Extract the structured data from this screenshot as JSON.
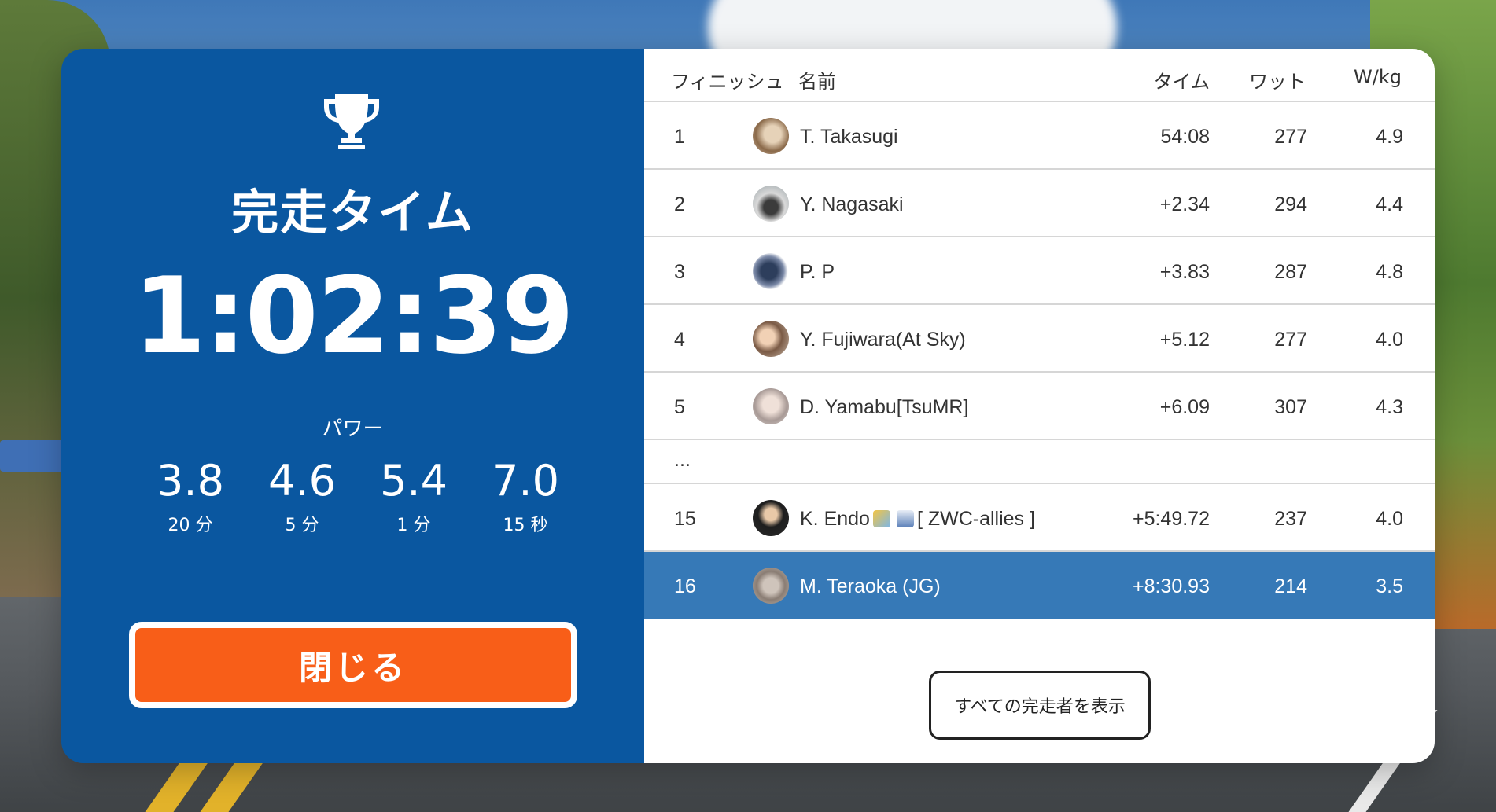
{
  "summary": {
    "title": "完走タイム",
    "finish_time": "1:02:39",
    "power_label": "パワー",
    "power": [
      {
        "value": "3.8",
        "duration": "20 分"
      },
      {
        "value": "4.6",
        "duration": "5 分"
      },
      {
        "value": "5.4",
        "duration": "1 分"
      },
      {
        "value": "7.0",
        "duration": "15 秒"
      }
    ],
    "close_label": "閉じる",
    "trophy_icon": "trophy-icon",
    "close_color": "#f85e18",
    "panel_color": "#0a57a0"
  },
  "table": {
    "headers": {
      "finish": "フィニッシュ",
      "name": "名前",
      "time": "タイム",
      "watt": "ワット",
      "wkg": "W/kg"
    },
    "rows": [
      {
        "pos": "1",
        "name": "T. Takasugi",
        "time": "54:08",
        "watt": "277",
        "wkg": "4.9"
      },
      {
        "pos": "2",
        "name": "Y. Nagasaki",
        "time": "+2.34",
        "watt": "294",
        "wkg": "4.4"
      },
      {
        "pos": "3",
        "name": "P. P",
        "time": "+3.83",
        "watt": "287",
        "wkg": "4.8"
      },
      {
        "pos": "4",
        "name": "Y. Fujiwara(At Sky)",
        "time": "+5.12",
        "watt": "277",
        "wkg": "4.0"
      },
      {
        "pos": "5",
        "name": "D. Yamabu[TsuMR]",
        "time": "+6.09",
        "watt": "307",
        "wkg": "4.3"
      }
    ],
    "ellipsis": "...",
    "endo": {
      "pos": "15",
      "name": "K. Endo",
      "team": "[ ZWC-allies ]",
      "time": "+5:49.72",
      "watt": "237",
      "wkg": "4.0"
    },
    "me": {
      "pos": "16",
      "name": "M. Teraoka (JG)",
      "time": "+8:30.93",
      "watt": "214",
      "wkg": "3.5"
    },
    "highlight_color": "#3679b7",
    "show_all_label": "すべての完走者を表示"
  }
}
